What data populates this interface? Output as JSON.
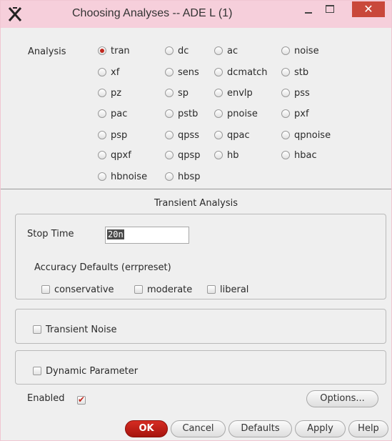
{
  "window": {
    "title": "Choosing Analyses -- ADE L (1)",
    "close_glyph": "✕"
  },
  "analysis": {
    "label": "Analysis",
    "selected": "tran",
    "options": [
      "tran",
      "dc",
      "ac",
      "noise",
      "xf",
      "sens",
      "dcmatch",
      "stb",
      "pz",
      "sp",
      "envlp",
      "pss",
      "pac",
      "pstb",
      "pnoise",
      "pxf",
      "psp",
      "qpss",
      "qpac",
      "qpnoise",
      "qpxf",
      "qpsp",
      "hb",
      "hbac",
      "hbnoise",
      "hbsp"
    ]
  },
  "transient": {
    "section_title": "Transient Analysis",
    "stop_time_label": "Stop Time",
    "stop_time_value": "20n",
    "accuracy_label": "Accuracy Defaults (errpreset)",
    "accuracy_options": [
      "conservative",
      "moderate",
      "liberal"
    ],
    "transient_noise_label": "Transient Noise",
    "dynamic_parameter_label": "Dynamic Parameter",
    "enabled_label": "Enabled",
    "enabled_checked": true
  },
  "buttons": {
    "options": "Options...",
    "ok": "OK",
    "cancel": "Cancel",
    "defaults": "Defaults",
    "apply": "Apply",
    "help": "Help"
  },
  "colors": {
    "titlebar": "#f6cfdb",
    "close": "#c9483b",
    "accent": "#c0281e"
  }
}
